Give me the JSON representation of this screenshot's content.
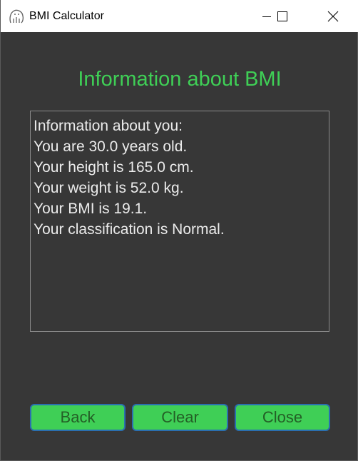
{
  "window": {
    "title": "BMI Calculator"
  },
  "title_controls": {
    "minimize_icon": "minimize-icon",
    "maximize_icon": "maximize-icon",
    "close_icon": "close-icon"
  },
  "main": {
    "heading": "Information about BMI",
    "info_lines": [
      "Information about you:",
      "You are 30.0 years old.",
      "Your height is 165.0 cm.",
      "Your weight is 52.0 kg.",
      "Your BMI is 19.1.",
      "Your classification is Normal."
    ]
  },
  "buttons": {
    "back": "Back",
    "clear": "Clear",
    "close": "Close"
  },
  "colors": {
    "background": "#373737",
    "accent": "#3fcf56",
    "button_border": "#2a6fb0",
    "text": "#ebebeb"
  }
}
